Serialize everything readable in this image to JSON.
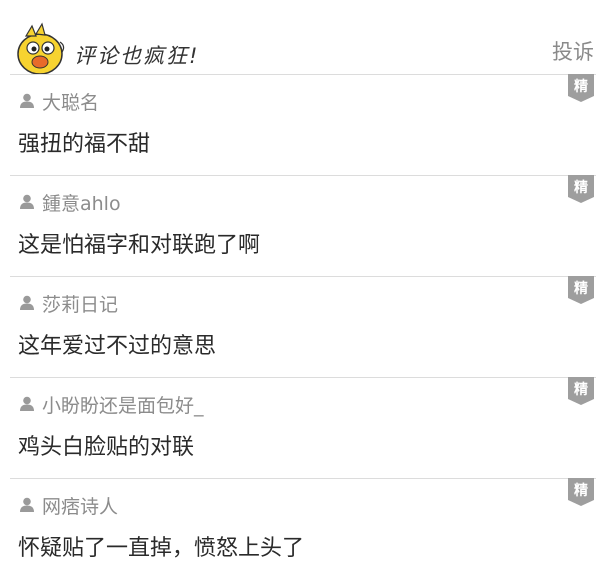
{
  "header": {
    "title": "评论也疯狂!",
    "report_label": "投诉",
    "mascot_icon": "yellow-duck-mascot"
  },
  "comments": [
    {
      "username": "大聪名",
      "content": "强扭的福不甜",
      "badge": "精"
    },
    {
      "username": "鍾意ahlo",
      "content": "这是怕福字和对联跑了啊",
      "badge": "精"
    },
    {
      "username": "莎莉日记",
      "content": "这年爱过不过的意思",
      "badge": "精"
    },
    {
      "username": "小盼盼还是面包好_",
      "content": "鸡头白脸贴的对联",
      "badge": "精"
    },
    {
      "username": "网痞诗人",
      "content": "怀疑贴了一直掉，愤怒上头了",
      "badge": "精"
    }
  ],
  "colors": {
    "badge_bg": "#9e9e9e",
    "divider": "#dcdcdc",
    "username": "#8c8c8c"
  }
}
